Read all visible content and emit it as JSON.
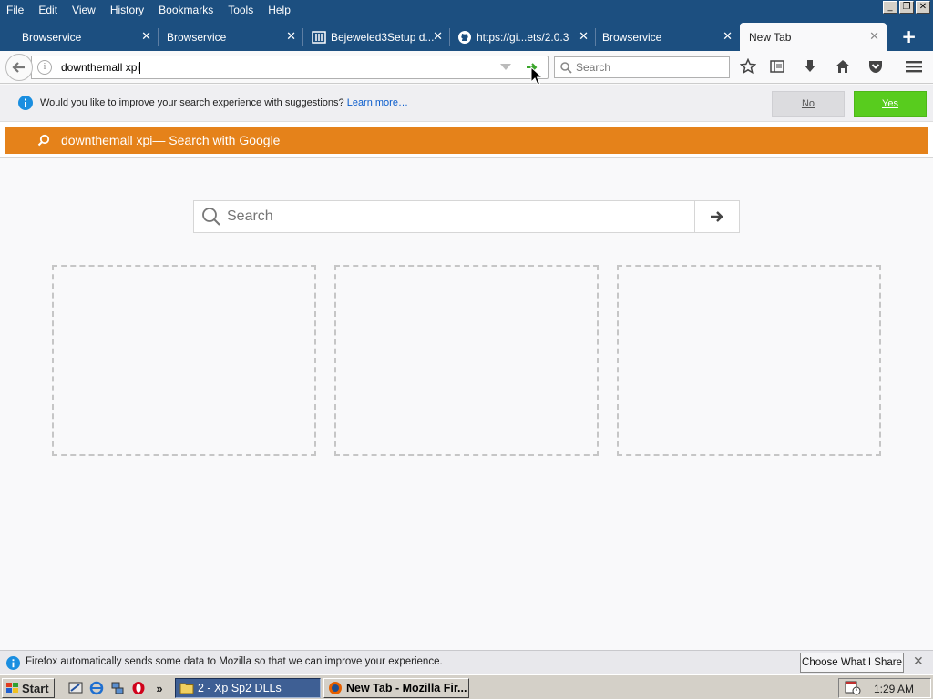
{
  "menubar": {
    "items": [
      "File",
      "Edit",
      "View",
      "History",
      "Bookmarks",
      "Tools",
      "Help"
    ]
  },
  "tabs": [
    {
      "title": "Browservice",
      "icon": "none",
      "active": false
    },
    {
      "title": "Browservice",
      "icon": "none",
      "active": false
    },
    {
      "title": "Bejeweled3Setup d...",
      "icon": "archive-icon",
      "active": false
    },
    {
      "title": "https://gi...ets/2.0.3",
      "icon": "github-icon",
      "active": false
    },
    {
      "title": "Browservice",
      "icon": "none",
      "active": false
    },
    {
      "title": "New Tab",
      "icon": "none",
      "active": true
    }
  ],
  "navbar": {
    "url_value": "downthemall xpi",
    "search_placeholder": "Search"
  },
  "notification": {
    "text": "Would you like to improve your search experience with suggestions?",
    "link": "Learn more…",
    "no_label": "No",
    "yes_label": "Yes"
  },
  "suggestion": {
    "query": "downthemall xpi",
    "suffix": " — Search with Google"
  },
  "content": {
    "search_placeholder": "Search",
    "tile_count": 3
  },
  "bottom_notification": {
    "text": "Firefox automatically sends some data to Mozilla so that we can improve your experience.",
    "button_label": "Choose What I Share"
  },
  "taskbar": {
    "start_label": "Start",
    "overflow_label": "»",
    "buttons": [
      {
        "label": "2 - Xp Sp2 DLLs",
        "icon": "folder-icon",
        "state": "selected"
      },
      {
        "label": "New Tab - Mozilla Fir...",
        "icon": "firefox-icon",
        "state": "active"
      }
    ],
    "clock": "1:29 AM"
  },
  "colors": {
    "titlebar_blue": "#1c4f80",
    "suggestion_orange": "#e5821a",
    "yes_green": "#58cc1e",
    "info_blue": "#1a8ee0"
  }
}
